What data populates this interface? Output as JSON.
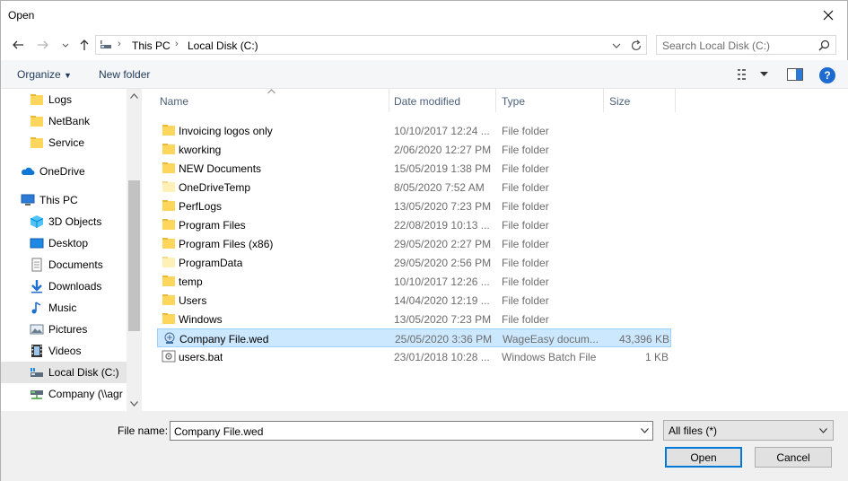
{
  "window": {
    "title": "Open"
  },
  "address": {
    "crumbs": [
      "This PC",
      "Local Disk (C:)"
    ]
  },
  "search": {
    "placeholder": "Search Local Disk (C:)"
  },
  "commandbar": {
    "organize": "Organize",
    "new_folder": "New folder",
    "help": "?"
  },
  "nav": {
    "items": [
      {
        "label": "Logs",
        "icon": "folder-icon"
      },
      {
        "label": "NetBank",
        "icon": "folder-icon"
      },
      {
        "label": "Service",
        "icon": "folder-icon"
      },
      {
        "label": "OneDrive",
        "icon": "onedrive-icon"
      },
      {
        "label": "This PC",
        "icon": "this-pc-icon"
      },
      {
        "label": "3D Objects",
        "icon": "3d-objects-icon"
      },
      {
        "label": "Desktop",
        "icon": "desktop-icon"
      },
      {
        "label": "Documents",
        "icon": "documents-icon"
      },
      {
        "label": "Downloads",
        "icon": "downloads-icon"
      },
      {
        "label": "Music",
        "icon": "music-icon"
      },
      {
        "label": "Pictures",
        "icon": "pictures-icon"
      },
      {
        "label": "Videos",
        "icon": "videos-icon"
      },
      {
        "label": "Local Disk (C:)",
        "icon": "local-disk-icon"
      },
      {
        "label": "Company (\\\\agr",
        "icon": "network-drive-icon"
      }
    ]
  },
  "columns": {
    "name": "Name",
    "date": "Date modified",
    "type": "Type",
    "size": "Size"
  },
  "files": [
    {
      "name": "Invoicing logos only",
      "date": "10/10/2017 12:24 ...",
      "type": "File folder",
      "size": "",
      "icon": "folder-icon"
    },
    {
      "name": "kworking",
      "date": "2/06/2020 12:27 PM",
      "type": "File folder",
      "size": "",
      "icon": "folder-icon"
    },
    {
      "name": "NEW Documents",
      "date": "15/05/2019 1:38 PM",
      "type": "File folder",
      "size": "",
      "icon": "folder-icon"
    },
    {
      "name": "OneDriveTemp",
      "date": "8/05/2020 7:52 AM",
      "type": "File folder",
      "size": "",
      "icon": "folder-light-icon"
    },
    {
      "name": "PerfLogs",
      "date": "13/05/2020 7:23 PM",
      "type": "File folder",
      "size": "",
      "icon": "folder-icon"
    },
    {
      "name": "Program Files",
      "date": "22/08/2019 10:13 ...",
      "type": "File folder",
      "size": "",
      "icon": "folder-icon"
    },
    {
      "name": "Program Files (x86)",
      "date": "29/05/2020 2:27 PM",
      "type": "File folder",
      "size": "",
      "icon": "folder-icon"
    },
    {
      "name": "ProgramData",
      "date": "29/05/2020 2:56 PM",
      "type": "File folder",
      "size": "",
      "icon": "folder-light-icon"
    },
    {
      "name": "temp",
      "date": "10/10/2017 12:26 ...",
      "type": "File folder",
      "size": "",
      "icon": "folder-icon"
    },
    {
      "name": "Users",
      "date": "14/04/2020 12:19 ...",
      "type": "File folder",
      "size": "",
      "icon": "folder-icon"
    },
    {
      "name": "Windows",
      "date": "13/05/2020 7:23 PM",
      "type": "File folder",
      "size": "",
      "icon": "folder-icon"
    },
    {
      "name": "Company File.wed",
      "date": "25/05/2020 3:36 PM",
      "type": "WageEasy docum...",
      "size": "43,396 KB",
      "icon": "wageeasy-file-icon",
      "selected": true
    },
    {
      "name": "users.bat",
      "date": "23/01/2018 10:28 ...",
      "type": "Windows Batch File",
      "size": "1 KB",
      "icon": "batch-file-icon"
    }
  ],
  "footer": {
    "filename_label": "File name:",
    "filename_value": "Company File.wed",
    "filter_value": "All files (*)",
    "open_label": "Open",
    "cancel_label": "Cancel"
  },
  "colors": {
    "folder": "#ffd65c",
    "selection": "#cce8ff",
    "accent": "#0078d7"
  }
}
